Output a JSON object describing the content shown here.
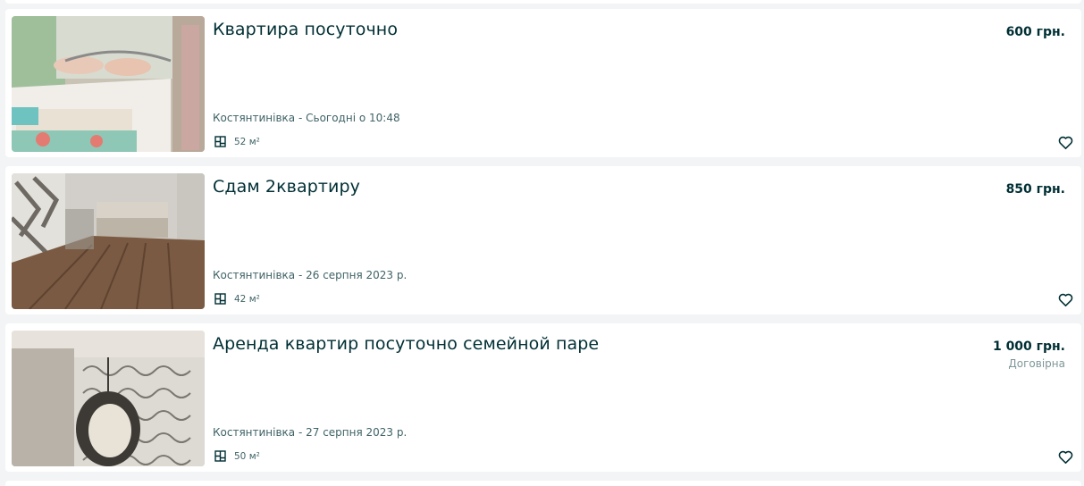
{
  "listings": [
    {
      "title": "Квартира посуточно",
      "price": "600 грн.",
      "negotiable": "",
      "location_date": "Костянтинівка - Сьогодні о 10:48",
      "area": "52 м²",
      "icons": {
        "area": "floor-plan-icon",
        "favorite": "heart-outline-icon"
      }
    },
    {
      "title": "Сдам 2квартиру",
      "price": "850 грн.",
      "negotiable": "",
      "location_date": "Костянтинівка - 26 серпня 2023 р.",
      "area": "42 м²",
      "icons": {
        "area": "floor-plan-icon",
        "favorite": "heart-outline-icon"
      }
    },
    {
      "title": "Аренда квартир посуточно семейной паре",
      "price": "1 000 грн.",
      "negotiable": "Договірна",
      "location_date": "Костянтинівка - 27 серпня 2023 р.",
      "area": "50 м²",
      "icons": {
        "area": "floor-plan-icon",
        "favorite": "heart-outline-icon"
      }
    }
  ],
  "colors": {
    "page_background": "#f2f4f5",
    "card_background": "#ffffff",
    "title_text": "#002f34",
    "secondary_text": "#406367",
    "muted_text": "#7f9799"
  }
}
